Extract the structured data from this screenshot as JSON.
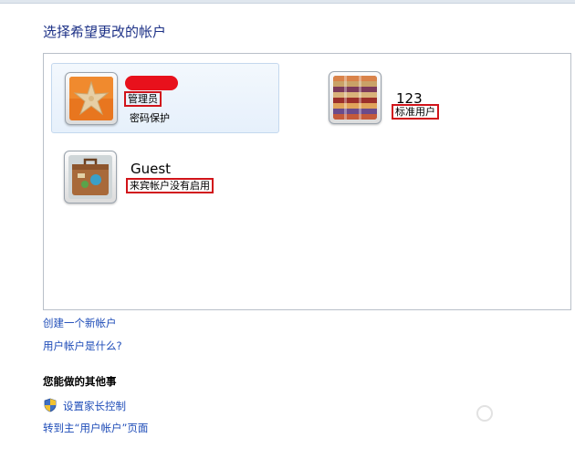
{
  "page": {
    "title": "选择希望更改的帐户"
  },
  "accounts": [
    {
      "name": "",
      "type": "管理员",
      "status": "密码保护",
      "picture": "starfish-icon",
      "selected": true
    },
    {
      "name": "123",
      "type": "标准用户",
      "picture": "color-chart-icon"
    },
    {
      "name": "Guest",
      "type": "来宾帐户没有启用",
      "picture": "suitcase-icon"
    }
  ],
  "links": {
    "create_account": "创建一个新帐户",
    "what_is_account": "用户帐户是什么?"
  },
  "other_tasks": {
    "title": "您能做的其他事",
    "parental_controls": "设置家长控制",
    "go_to_main": "转到主“用户帐户”页面"
  },
  "colors": {
    "link": "#1e4cb8",
    "title": "#1e3287",
    "annotation_box": "#d1141a"
  }
}
